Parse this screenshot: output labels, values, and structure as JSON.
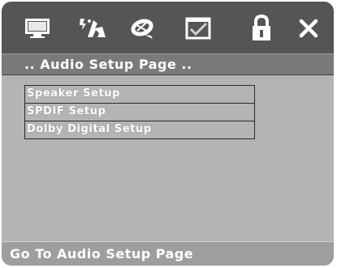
{
  "toolbar": {
    "icons": [
      {
        "name": "general-setup-icon"
      },
      {
        "name": "audio-setup-icon"
      },
      {
        "name": "dolby-icon"
      },
      {
        "name": "preference-icon"
      },
      {
        "name": "password-lock-icon"
      },
      {
        "name": "exit-icon"
      }
    ]
  },
  "page": {
    "title": ".. Audio Setup Page .."
  },
  "menu": {
    "items": [
      {
        "label": "Speaker Setup"
      },
      {
        "label": "SPDIF Setup"
      },
      {
        "label": "Dolby Digital Setup"
      }
    ]
  },
  "status": {
    "text": "Go To Audio Setup Page"
  },
  "colors": {
    "toolbar_bg": "#555555",
    "title_bg": "#7a7a7a",
    "panel_bg": "#b4b4b4",
    "status_bg": "#9e9e9e",
    "text": "#ffffff"
  }
}
